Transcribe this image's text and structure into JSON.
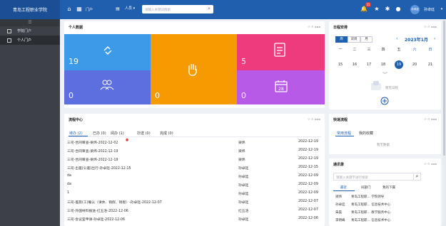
{
  "header": {
    "school_name": "青岛工程职业学院",
    "portal_label": "门户",
    "person_select": "人员",
    "search_placeholder": "请输入关键词搜索",
    "notification_count": "15",
    "user_name": "孙卓廷",
    "avatar_text": "孙卓廷"
  },
  "sidebar": {
    "items": [
      {
        "label": "学院门户"
      },
      {
        "label": "个人门户"
      }
    ]
  },
  "personal_data": {
    "title": "个人数据",
    "tiles": [
      {
        "value": "19",
        "color": "#3d9ae8"
      },
      {
        "value": "0",
        "color": "#f59a00"
      },
      {
        "value": "5",
        "color": "#ee3b7e"
      },
      {
        "value": "0",
        "color": "#5d6fde"
      },
      {
        "value": "0",
        "color": "#b85ae8"
      }
    ]
  },
  "schedule": {
    "title": "日程安排",
    "view_day": "周",
    "view_week": "双周",
    "view_month": "月",
    "month_label": "2023年1月",
    "weekdays": [
      "一",
      "二",
      "三",
      "四",
      "五",
      "六",
      "日"
    ],
    "days": [
      "15",
      "16",
      "17",
      "18",
      "19",
      "20",
      "21"
    ],
    "empty_text": "暂无日程"
  },
  "process_center": {
    "title": "流程中心",
    "tabs": [
      "待办 (2)",
      "已办 (0)",
      "阅办 (1)",
      "抄送 (0)",
      "完成 (0)"
    ],
    "rows": [
      {
        "name": "三司-合同审查-梁炜-2022-12-02",
        "user": "梁炜",
        "date": "2022-12-19"
      },
      {
        "name": "三司-合同审查-梁炜-2022-12-19",
        "user": "梁炜",
        "date": "2022-12-19"
      },
      {
        "name": "三司-合同审查-梁炜-2022-12-19",
        "user": "梁炜",
        "date": "2022-12-19"
      },
      {
        "name": "三司-出差(公差)出行-孙卓廷-2022-12-15",
        "user": "孙卓廷",
        "date": "2022-12-15"
      },
      {
        "name": "da",
        "user": "孙卓廷",
        "date": "2022-12-09"
      },
      {
        "name": "da",
        "user": "孙卓廷",
        "date": "2022-12-09"
      },
      {
        "name": "1",
        "user": "孙卓廷",
        "date": "2022-12-09"
      },
      {
        "name": "三司-差旅(工)确认（请休、销假、销假）-孙卓廷-2022-12-07",
        "user": "孙卓廷",
        "date": "2022-12-07"
      },
      {
        "name": "三司-外国材料报送-红五洛-2022-12-06",
        "user": "红五洛",
        "date": "2022-12-07"
      },
      {
        "name": "三司-会议室申请-孙卓廷-2022-12-06",
        "user": "孙卓廷",
        "date": "2022-12-06"
      }
    ]
  },
  "quick_flow": {
    "title": "快速流程",
    "tab_common": "常用流程",
    "tab_favorite": "我的收藏",
    "empty_text": "暂无数据"
  },
  "contacts": {
    "title": "通讯录",
    "search_placeholder": "请输入关键字进行搜索",
    "tabs": [
      "最近",
      "同部门",
      "我的下属"
    ],
    "rows": [
      {
        "name": "梁炜",
        "dept": "青岛工程职... 学院领导"
      },
      {
        "name": "孙卓廷",
        "dept": "青岛工程职... 信息技术中心"
      },
      {
        "name": "朱磊",
        "dept": "青岛工程职... 教学服务中心"
      },
      {
        "name": "李明峰",
        "dept": "青岛工程职... 信息技术中心"
      }
    ]
  },
  "colors": {
    "header": "#1f5fae",
    "accent": "#1f5fae",
    "today": "#1f5fae"
  }
}
